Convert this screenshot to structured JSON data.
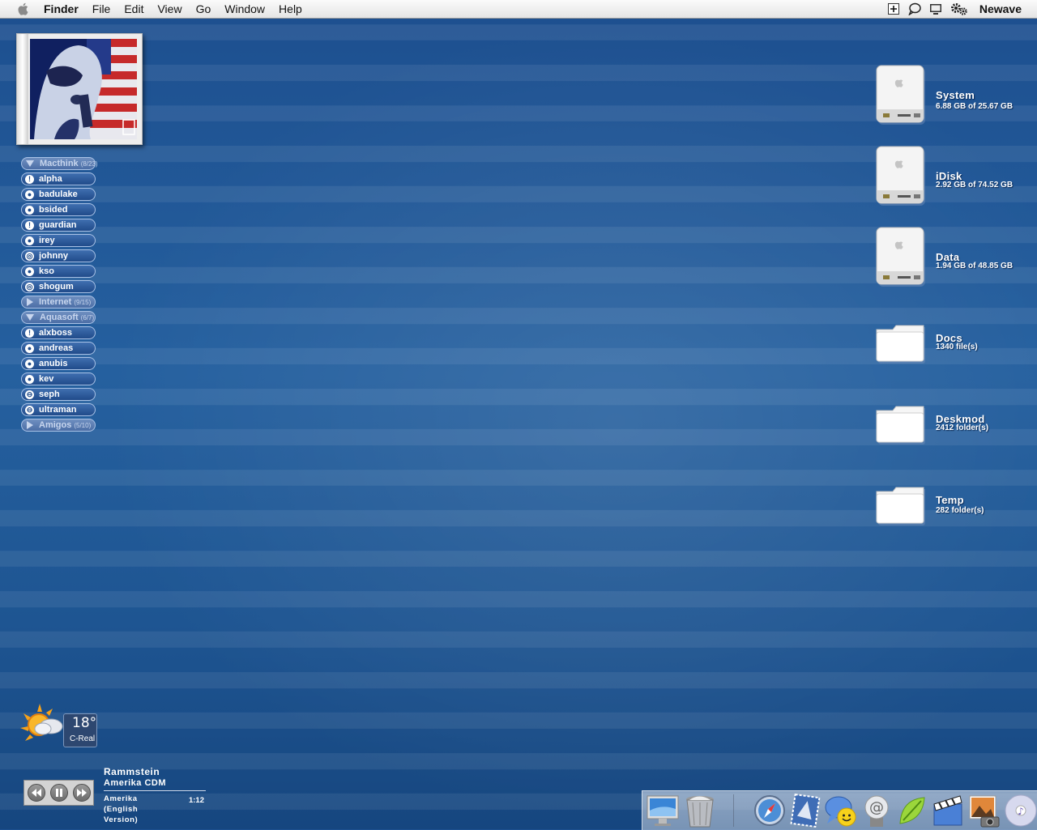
{
  "menubar": {
    "app": "Finder",
    "menus": [
      "File",
      "Edit",
      "View",
      "Go",
      "Window",
      "Help"
    ],
    "user": "Newave"
  },
  "buddy_list": {
    "groups": [
      {
        "name": "Macthink",
        "count": "(8/23)",
        "expanded": true,
        "buddies": [
          "alpha",
          "badulake",
          "bsided",
          "guardian",
          "irey",
          "johnny",
          "kso",
          "shogum"
        ]
      },
      {
        "name": "Internet",
        "count": "(9/15)",
        "expanded": false,
        "buddies": []
      },
      {
        "name": "Aquasoft",
        "count": "(6/7)",
        "expanded": true,
        "buddies": [
          "alxboss",
          "andreas",
          "anubis",
          "kev",
          "seph",
          "ultraman"
        ]
      },
      {
        "name": "Amigos",
        "count": "(5/10)",
        "expanded": false,
        "buddies": []
      }
    ]
  },
  "desktop_items": [
    {
      "name": "System",
      "detail": "6.88 GB of 25.67 GB",
      "kind": "drive"
    },
    {
      "name": "iDisk",
      "detail": "2.92 GB of 74.52 GB",
      "kind": "drive"
    },
    {
      "name": "Data",
      "detail": "1.94 GB of 48.85 GB",
      "kind": "drive"
    },
    {
      "name": "Docs",
      "detail": "1340 file(s)",
      "kind": "folder"
    },
    {
      "name": "Deskmod",
      "detail": "2412 folder(s)",
      "kind": "folder"
    },
    {
      "name": "Temp",
      "detail": "282 folder(s)",
      "kind": "folder"
    }
  ],
  "weather": {
    "temp": "18°",
    "city": "C-Real"
  },
  "now_playing": {
    "artist": "Rammstein",
    "album": "Amerika CDM",
    "song": "Amerika (English Version)",
    "time": "1:12"
  },
  "dock": {
    "items": [
      "finder-icon",
      "trash-icon",
      "safari-icon",
      "mail-icon",
      "ichat-icon",
      "email-icon",
      "itunes-icon",
      "imovie-icon",
      "iphoto-icon",
      "cd-icon"
    ]
  }
}
